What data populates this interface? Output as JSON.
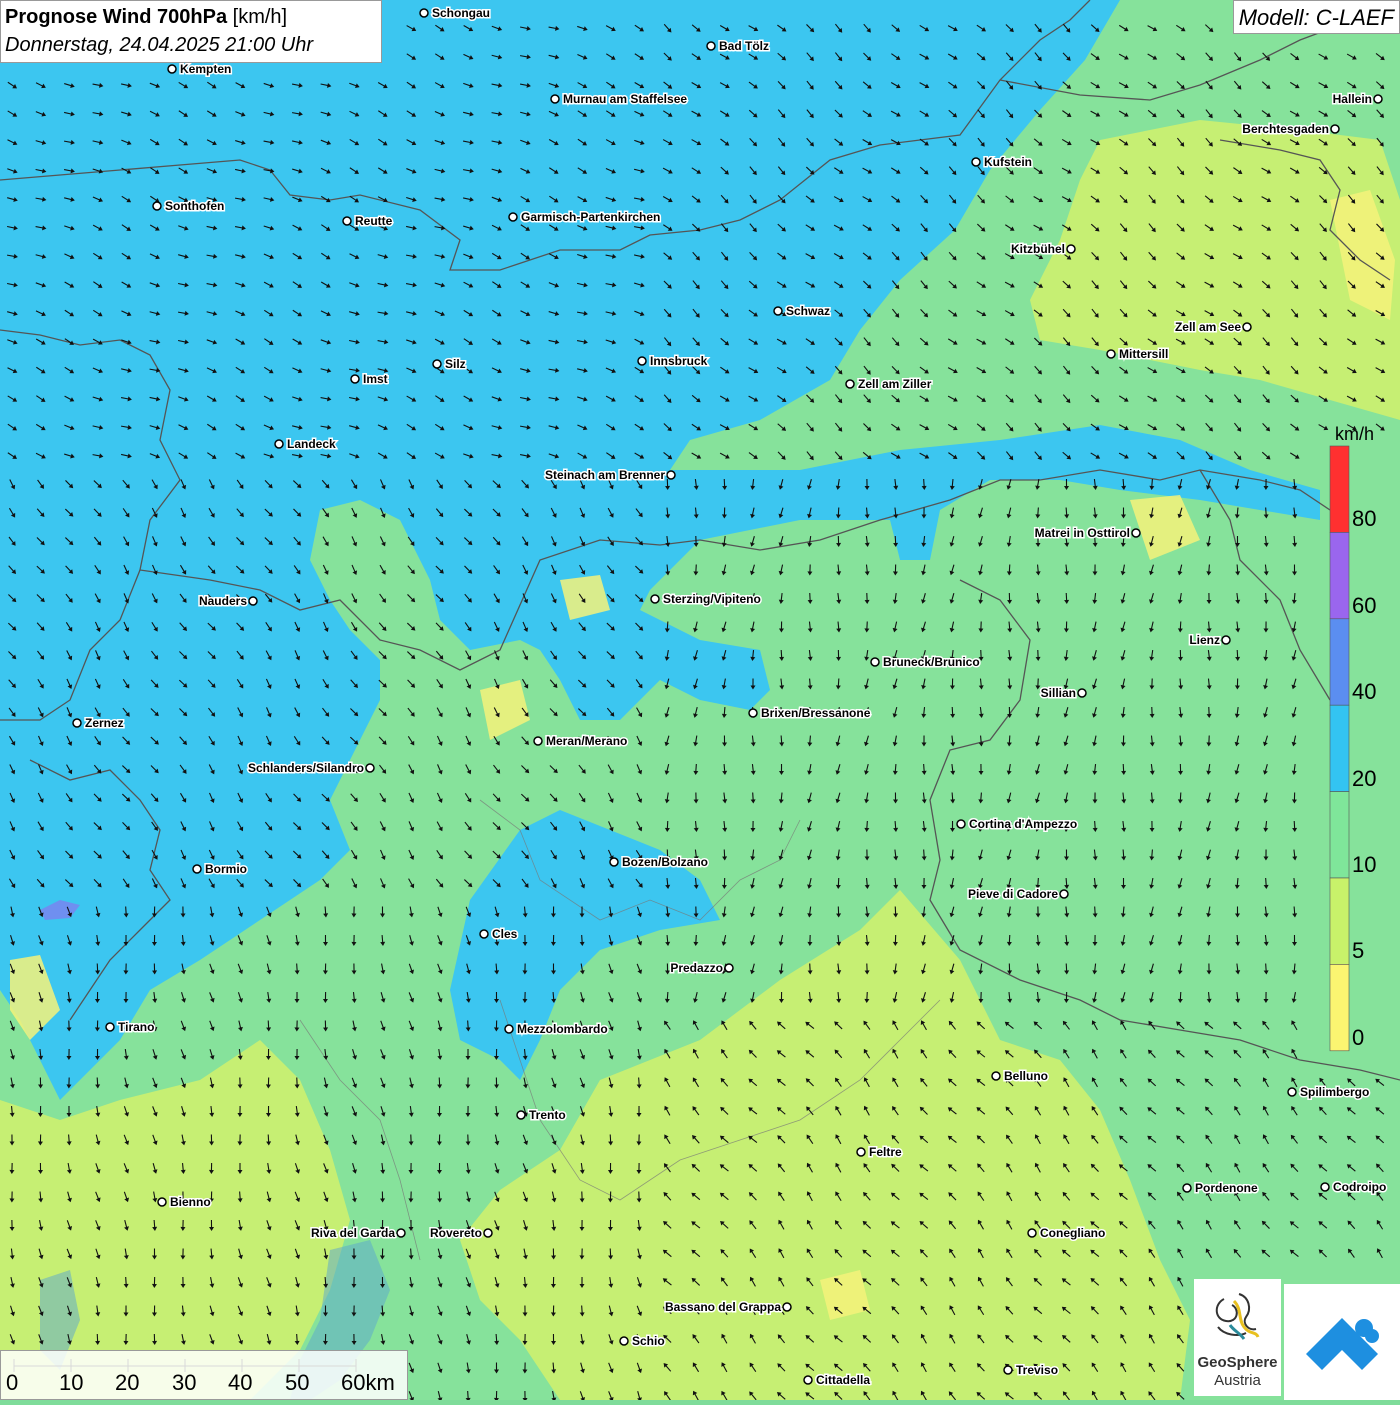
{
  "title": {
    "bold": "Prognose Wind 700hPa",
    "unit": "[km/h]",
    "datetime": "Donnerstag, 24.04.2025 21:00 Uhr"
  },
  "model_label": "Modell: C-LAEF",
  "legend": {
    "unit": "km/h",
    "ticks": [
      "80",
      "60",
      "40",
      "20",
      "10",
      "5",
      "0"
    ],
    "colors": [
      "#ff3030",
      "#9a66ee",
      "#5b8ef0",
      "#33c4f2",
      "#7fe69a",
      "#c8f26a",
      "#fbf571"
    ]
  },
  "scale_bar": {
    "labels": [
      "0",
      "10",
      "20",
      "30",
      "40",
      "50",
      "60km"
    ]
  },
  "logo": {
    "name": "GeoSphere",
    "sub": "Austria"
  },
  "cities": [
    {
      "name": "Schongau"
    },
    {
      "name": "Bad Tölz"
    },
    {
      "name": "Kempten"
    },
    {
      "name": "Murnau am Staffelsee"
    },
    {
      "name": "Hallein"
    },
    {
      "name": "Berchtesgaden"
    },
    {
      "name": "Kufstein"
    },
    {
      "name": "Sonthofen"
    },
    {
      "name": "Reutte"
    },
    {
      "name": "Garmisch-Partenkirchen"
    },
    {
      "name": "Kitzbühel"
    },
    {
      "name": "Schwaz"
    },
    {
      "name": "Zell am See"
    },
    {
      "name": "Mittersill"
    },
    {
      "name": "Innsbruck"
    },
    {
      "name": "Silz"
    },
    {
      "name": "Imst"
    },
    {
      "name": "Zell am Ziller"
    },
    {
      "name": "Landeck"
    },
    {
      "name": "Steinach am Brenner"
    },
    {
      "name": "Matrei in Osttirol"
    },
    {
      "name": "Nauders"
    },
    {
      "name": "Sterzing/Vipiteno"
    },
    {
      "name": "Lienz"
    },
    {
      "name": "Bruneck/Brunico"
    },
    {
      "name": "Sillian"
    },
    {
      "name": "Brixen/Bressanone"
    },
    {
      "name": "Zernez"
    },
    {
      "name": "Meran/Merano"
    },
    {
      "name": "Schlanders/Silandro"
    },
    {
      "name": "Cortina d'Ampezzo"
    },
    {
      "name": "Bozen/Bolzano"
    },
    {
      "name": "Bormio"
    },
    {
      "name": "Pieve di Cadore"
    },
    {
      "name": "Cles"
    },
    {
      "name": "Predazzo"
    },
    {
      "name": "Tirano"
    },
    {
      "name": "Mezzolombardo"
    },
    {
      "name": "Belluno"
    },
    {
      "name": "Spilimbergo"
    },
    {
      "name": "Trento"
    },
    {
      "name": "Feltre"
    },
    {
      "name": "Pordenone"
    },
    {
      "name": "Codroipo"
    },
    {
      "name": "Bienno"
    },
    {
      "name": "Riva del Garda"
    },
    {
      "name": "Rovereto"
    },
    {
      "name": "Conegliano"
    },
    {
      "name": "Bassano del Grappa"
    },
    {
      "name": "Schio"
    },
    {
      "name": "Treviso"
    },
    {
      "name": "Cittadella"
    }
  ]
}
